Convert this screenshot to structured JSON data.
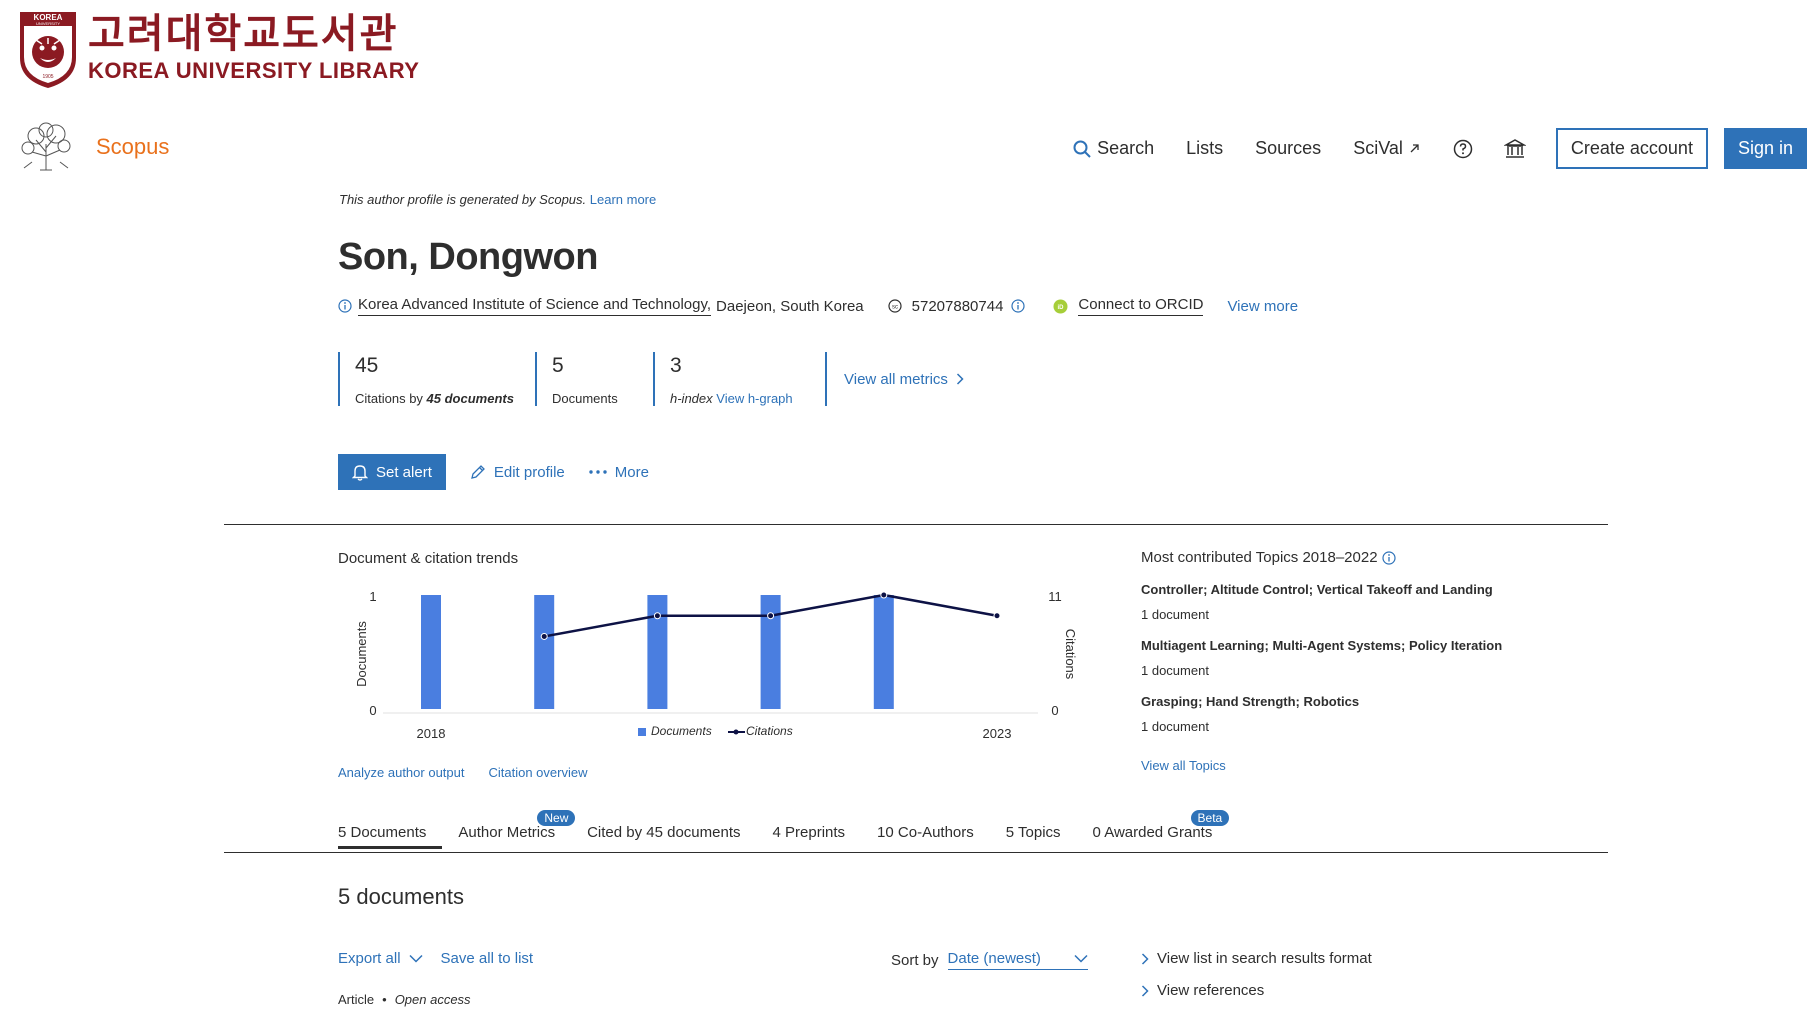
{
  "library": {
    "name_korean": "고려대학교도서관",
    "name_english": "KOREA UNIVERSITY LIBRARY",
    "emblem_top": "KOREA",
    "emblem_sub": "UNIVERSITY",
    "emblem_year": "1905",
    "brand_color": "#8b1a22"
  },
  "header": {
    "brand": "Scopus",
    "brand_color": "#e9711c",
    "nav": {
      "search": "Search",
      "lists": "Lists",
      "sources": "Sources",
      "scival": "SciVal"
    },
    "create_account": "Create account",
    "sign_in": "Sign in",
    "accent_color": "#2e72b8"
  },
  "profile": {
    "note": "This author profile is generated by Scopus.",
    "learn_more": "Learn more",
    "name": "Son, Dongwon",
    "affiliation": "Korea Advanced Institute of Science and Technology,",
    "location": "Daejeon, South Korea",
    "scopus_id": "57207880744",
    "orcid": "Connect to ORCID",
    "view_more": "View more"
  },
  "metrics": {
    "citations_value": "45",
    "citations_label_pre": "Citations by",
    "citations_label_em": "45 documents",
    "documents_value": "5",
    "documents_label": "Documents",
    "hindex_value": "3",
    "hindex_label": "h-index",
    "hindex_link": "View h-graph",
    "view_all": "View all metrics"
  },
  "actions": {
    "set_alert": "Set alert",
    "edit_profile": "Edit profile",
    "more": "More"
  },
  "trends": {
    "title": "Document & citation trends",
    "analyze": "Analyze author output",
    "citation_overview": "Citation overview"
  },
  "chart_data": {
    "type": "bar",
    "x": [
      2018,
      2019,
      2020,
      2021,
      2022,
      2023
    ],
    "x_tick_labels": [
      "2018",
      "2023"
    ],
    "series": [
      {
        "name": "Documents",
        "type": "bar",
        "axis": "left",
        "values": [
          1,
          1,
          1,
          1,
          1,
          0
        ],
        "color": "#4a7ee0"
      },
      {
        "name": "Citations",
        "type": "line",
        "axis": "right",
        "x": [
          2019,
          2020,
          2021,
          2022,
          2023
        ],
        "values": [
          7,
          9,
          9,
          11,
          9
        ],
        "color": "#0d1245"
      }
    ],
    "ylabel": "Documents",
    "y2label": "Citations",
    "ylim": [
      0,
      1
    ],
    "y2lim": [
      0,
      11
    ],
    "y_ticks": [
      "1",
      "0"
    ],
    "y2_ticks": [
      "11",
      "0"
    ],
    "legend_position": "bottom-center"
  },
  "topics": {
    "title": "Most contributed Topics 2018–2022",
    "items": [
      {
        "title": "Controller; Altitude Control; Vertical Takeoff and Landing",
        "count": "1 document"
      },
      {
        "title": "Multiagent Learning; Multi-Agent Systems; Policy Iteration",
        "count": "1 document"
      },
      {
        "title": "Grasping; Hand Strength; Robotics",
        "count": "1 document"
      }
    ],
    "view_all": "View all Topics"
  },
  "tabs": [
    {
      "label": "5 Documents",
      "active": true
    },
    {
      "label": "Author Metrics",
      "badge": "New"
    },
    {
      "label": "Cited by 45 documents"
    },
    {
      "label": "4 Preprints"
    },
    {
      "label": "10 Co-Authors"
    },
    {
      "label": "5 Topics"
    },
    {
      "label": "0 Awarded Grants",
      "badge": "Beta"
    }
  ],
  "documents": {
    "title": "5 documents",
    "export_all": "Export all",
    "save_all": "Save all to list",
    "sort_label": "Sort by",
    "sort_value": "Date (newest)",
    "view_list": "View list in search results format",
    "view_refs": "View references",
    "first_type": "Article",
    "first_access": "Open access"
  }
}
